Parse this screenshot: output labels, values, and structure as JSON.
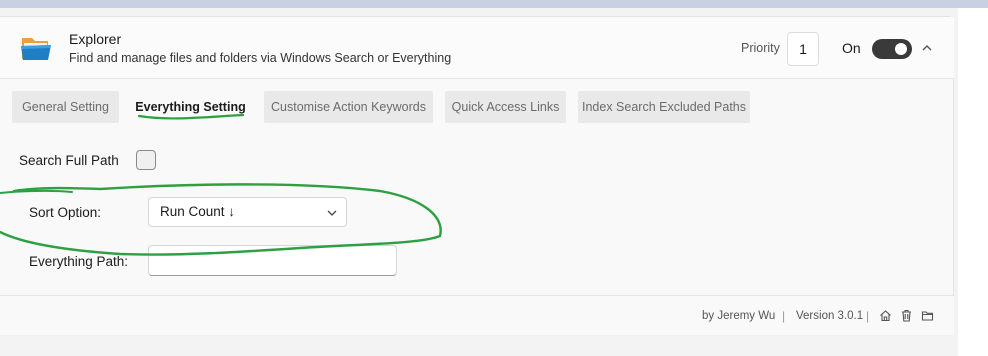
{
  "plugin": {
    "name": "Explorer",
    "description": "Find and manage files and folders via Windows Search or Everything",
    "priority_label": "Priority",
    "priority_value": "1",
    "toggle_label": "On",
    "enabled": true
  },
  "tabs": [
    {
      "label": "General Setting",
      "active": false
    },
    {
      "label": "Everything Setting",
      "active": true
    },
    {
      "label": "Customise Action Keywords",
      "active": false
    },
    {
      "label": "Quick Access Links",
      "active": false
    },
    {
      "label": "Index Search Excluded Paths",
      "active": false
    }
  ],
  "settings": {
    "search_full_path_label": "Search Full Path",
    "search_full_path_checked": false,
    "sort_option_label": "Sort Option:",
    "sort_option_value": "Run Count ↓",
    "everything_path_label": "Everything Path:",
    "everything_path_value": ""
  },
  "footer": {
    "author": "by Jeremy Wu",
    "separator": "|",
    "version": "Version 3.0.1",
    "icons": [
      "home-icon",
      "trash-icon",
      "folder-icon"
    ]
  },
  "colors": {
    "accent_annotation": "#2ea043",
    "toggle_on": "#3a3a3a"
  }
}
